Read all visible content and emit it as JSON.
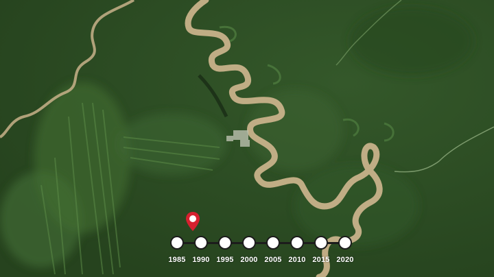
{
  "timeline": {
    "years": [
      "1985",
      "1990",
      "1995",
      "2000",
      "2005",
      "2010",
      "2015",
      "2020"
    ],
    "selected_index": 0,
    "marker_color": "#d6202f"
  },
  "map": {
    "type": "satellite",
    "features": [
      "meandering-river",
      "tributary-river",
      "oxbow-lakes",
      "settlement",
      "deforestation-strips"
    ]
  },
  "colors": {
    "forest": "#2f5226",
    "river": "#c8b28a",
    "node_fill": "#ffffff",
    "line": "#1c1c1c"
  }
}
